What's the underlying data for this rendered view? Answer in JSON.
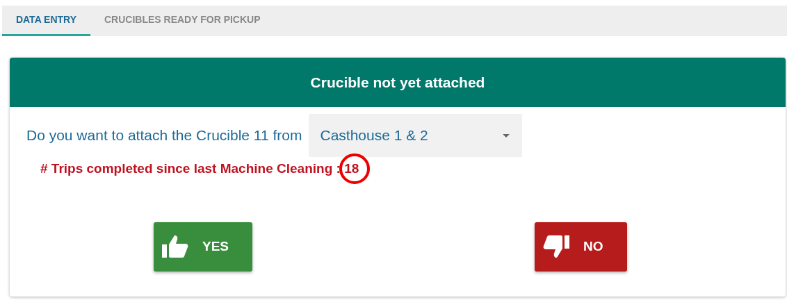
{
  "tabs": [
    {
      "label": "DATA ENTRY",
      "selected": true
    },
    {
      "label": "CRUCIBLES READY FOR PICKUP",
      "selected": false
    }
  ],
  "card": {
    "title": "Crucible not yet attached",
    "question": "Do you want to attach the Crucible 11 from",
    "select": {
      "value": "Casthouse 1 & 2"
    },
    "trips_label": "# Trips completed since last Machine Cleaning :",
    "trips_count": "18",
    "trips_highlighted": true,
    "buttons": [
      {
        "kind": "yes",
        "label": "YES"
      },
      {
        "kind": "no",
        "label": "NO"
      }
    ]
  }
}
